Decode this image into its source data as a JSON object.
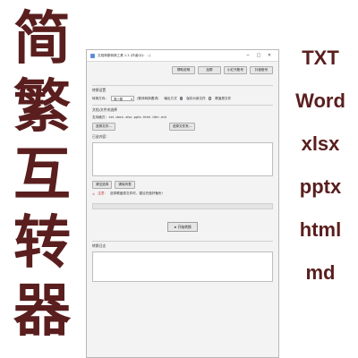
{
  "banner_left": [
    "简",
    "繁",
    "互",
    "转",
    "器"
  ],
  "formats_right": [
    "TXT",
    "Word",
    "xlsx",
    "pptx",
    "html",
    "md"
  ],
  "window": {
    "title": "文档简繁转换工具 1.2  (作者QQ：...)",
    "controls": {
      "minimize": "─",
      "maximize": "□",
      "close": "✕"
    },
    "top_buttons": [
      "帮助说明",
      "加群",
      "小红书账号",
      "抖音账号"
    ],
    "convert_settings": {
      "label": "转换设置",
      "direction_label": "转换方向：",
      "direction_value": "简→繁",
      "hint": "(繁体转换要求)",
      "save_label": "输出方式",
      "radio_save_new": "保存为新文件",
      "radio_overwrite": "覆盖原文件"
    },
    "files": {
      "label": "文档/文件夹选择",
      "supported": "支持格式：.txt .docx .xlsx .pptx .html .htm .md",
      "select_files": "选择文件...",
      "select_folder": "选择文件夹...",
      "selected_label": "已选内容：",
      "clear_selection": "清空选择",
      "clear_list": "清除列表",
      "note_prefix": "注意：",
      "note_text": "选择覆盖原文件时，建议先做好备份！"
    },
    "start_button": "开始转换",
    "log_label": "转换日志"
  }
}
